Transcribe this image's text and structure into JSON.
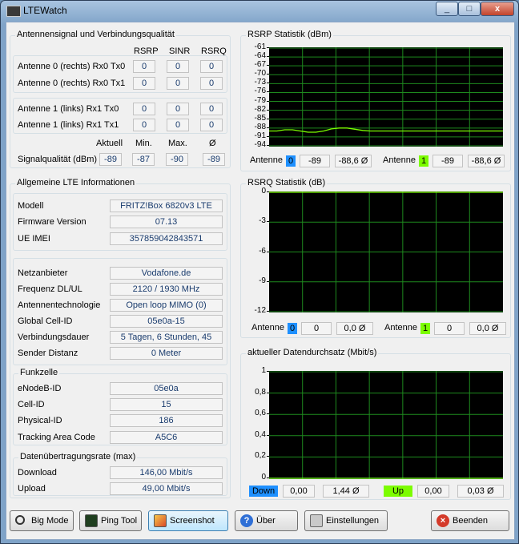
{
  "window": {
    "title": "LTEWatch",
    "min_glyph": "_",
    "max_glyph": "□",
    "close_glyph": "x"
  },
  "signal": {
    "title": "Antennensignal und Verbindungsqualität",
    "headers": [
      "RSRP",
      "SINR",
      "RSRQ"
    ],
    "rows": [
      {
        "label": "Antenne 0 (rechts) Rx0 Tx0",
        "values": [
          "0",
          "0",
          "0"
        ]
      },
      {
        "label": "Antenne 0 (rechts) Rx0 Tx1",
        "values": [
          "0",
          "0",
          "0"
        ]
      },
      {
        "label": "Antenne 1 (links) Rx1 Tx0",
        "values": [
          "0",
          "0",
          "0"
        ]
      },
      {
        "label": "Antenne 1 (links) Rx1 Tx1",
        "values": [
          "0",
          "0",
          "0"
        ]
      }
    ],
    "quality_headers": [
      "Aktuell",
      "Min.",
      "Max.",
      "Ø"
    ],
    "quality_label": "Signalqualität (dBm)",
    "quality_values": [
      "-89",
      "-87",
      "-90",
      "-89"
    ]
  },
  "lte_info": {
    "title": "Allgemeine LTE Informationen",
    "device": [
      {
        "label": "Modell",
        "value": "FRITZ!Box 6820v3 LTE"
      },
      {
        "label": "Firmware Version",
        "value": "07.13"
      },
      {
        "label": "UE IMEI",
        "value": "357859042843571"
      }
    ],
    "network": [
      {
        "label": "Netzanbieter",
        "value": "Vodafone.de"
      },
      {
        "label": "Frequenz DL/UL",
        "value": "2120 / 1930 MHz"
      },
      {
        "label": "Antennentechnologie",
        "value": "Open loop MIMO (0)"
      },
      {
        "label": "Global Cell-ID",
        "value": "05e0a-15"
      },
      {
        "label": "Verbindungsdauer",
        "value": "5 Tagen, 6 Stunden, 45"
      },
      {
        "label": "Sender Distanz",
        "value": "0 Meter"
      }
    ],
    "cell_title": "Funkzelle",
    "cell": [
      {
        "label": "eNodeB-ID",
        "value": "05e0a"
      },
      {
        "label": "Cell-ID",
        "value": "15"
      },
      {
        "label": "Physical-ID",
        "value": "186"
      },
      {
        "label": "Tracking Area Code",
        "value": "A5C6"
      }
    ],
    "rate_title": "Datenübertragungsrate (max)",
    "rate": [
      {
        "label": "Download",
        "value": "146,00 Mbit/s"
      },
      {
        "label": "Upload",
        "value": "49,00 Mbit/s"
      }
    ]
  },
  "rsrp_chart": {
    "title": "RSRP Statistik (dBm)",
    "legend": [
      {
        "label": "Antenne",
        "badge": "0",
        "color": "#1e90ff",
        "current": "-89",
        "avg": "-88,6 Ø"
      },
      {
        "label": "Antenne",
        "badge": "1",
        "color": "#7cfc00",
        "current": "-89",
        "avg": "-88,6 Ø"
      }
    ]
  },
  "rsrq_chart": {
    "title": "RSRQ Statistik (dB)",
    "legend": [
      {
        "label": "Antenne",
        "badge": "0",
        "color": "#1e90ff",
        "current": "0",
        "avg": "0,0 Ø"
      },
      {
        "label": "Antenne",
        "badge": "1",
        "color": "#7cfc00",
        "current": "0",
        "avg": "0,0 Ø"
      }
    ]
  },
  "throughput_chart": {
    "title": "aktueller Datendurchsatz (Mbit/s)",
    "legend": [
      {
        "label": "Down",
        "color": "#1e90ff",
        "current": "0,00",
        "avg": "1,44 Ø"
      },
      {
        "label": "Up",
        "color": "#7cfc00",
        "current": "0,00",
        "avg": "0,03 Ø"
      }
    ]
  },
  "chart_data": [
    {
      "type": "line",
      "title": "RSRP Statistik (dBm)",
      "ylim": [
        -94,
        -61
      ],
      "yticks": [
        "-61",
        "-64",
        "-67",
        "-70",
        "-73",
        "-76",
        "-79",
        "-82",
        "-85",
        "-88",
        "-91",
        "-94"
      ],
      "grid": true,
      "x": [
        0,
        1,
        2,
        3,
        4,
        5,
        6,
        7,
        8,
        9,
        10,
        11,
        12,
        13,
        14,
        15,
        16,
        17,
        18,
        19,
        20,
        21,
        22,
        23,
        24,
        25,
        26,
        27,
        28,
        29,
        30
      ],
      "series": [
        {
          "color": "#7cfc00",
          "values": [
            -89,
            -89,
            -88.6,
            -88.6,
            -89,
            -89.4,
            -89.4,
            -89,
            -88.3,
            -88,
            -88,
            -88.4,
            -88.8,
            -89,
            -89,
            -89,
            -89,
            -89,
            -89,
            -89,
            -89,
            -89,
            -89,
            -89,
            -89,
            -89,
            -89,
            -89,
            -89,
            -89,
            -89
          ]
        }
      ]
    },
    {
      "type": "line",
      "title": "RSRQ Statistik (dB)",
      "ylim": [
        -12,
        0
      ],
      "yticks": [
        "0",
        "-3",
        "-6",
        "-9",
        "-12"
      ],
      "grid": true,
      "x": [
        0,
        30
      ],
      "series": [
        {
          "color": "#7cfc00",
          "values": [
            0,
            0
          ]
        }
      ]
    },
    {
      "type": "line",
      "title": "aktueller Datendurchsatz (Mbit/s)",
      "ylim": [
        0,
        1
      ],
      "yticks": [
        "1",
        "0,8",
        "0,6",
        "0,4",
        "0,2",
        "0"
      ],
      "grid": true,
      "x": [
        0,
        30
      ],
      "series": [
        {
          "color": "#1e90ff",
          "values": [
            0,
            0
          ]
        },
        {
          "color": "#7cfc00",
          "values": [
            0,
            0
          ]
        }
      ]
    }
  ],
  "buttons": [
    {
      "name": "big-mode-button",
      "label": "Big Mode",
      "icon": "magnifier-icon"
    },
    {
      "name": "ping-tool-button",
      "label": "Ping Tool",
      "icon": "terminal-icon"
    },
    {
      "name": "screenshot-button",
      "label": "Screenshot",
      "icon": "screenshot-icon"
    },
    {
      "name": "about-button",
      "label": "Über",
      "icon": "help-icon"
    },
    {
      "name": "settings-button",
      "label": "Einstellungen",
      "icon": "settings-icon"
    },
    {
      "name": "quit-button",
      "label": "Beenden",
      "icon": "close-icon"
    }
  ]
}
